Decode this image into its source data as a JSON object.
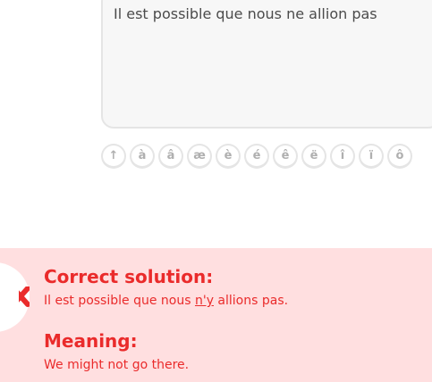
{
  "exercise": {
    "answer_value": "Il est possible que nous ne allion pas"
  },
  "keyboard": {
    "keys": [
      {
        "label": "↑",
        "name": "key-shift"
      },
      {
        "label": "à",
        "name": "key-a-grave"
      },
      {
        "label": "â",
        "name": "key-a-circumflex"
      },
      {
        "label": "æ",
        "name": "key-ae"
      },
      {
        "label": "è",
        "name": "key-e-grave"
      },
      {
        "label": "é",
        "name": "key-e-acute"
      },
      {
        "label": "ê",
        "name": "key-e-circumflex"
      },
      {
        "label": "ë",
        "name": "key-e-diaeresis"
      },
      {
        "label": "î",
        "name": "key-i-circumflex"
      },
      {
        "label": "ï",
        "name": "key-i-diaeresis"
      },
      {
        "label": "ô",
        "name": "key-o-circumflex"
      }
    ]
  },
  "feedback": {
    "status_icon": "close-icon",
    "accent_color": "#ea2b2b",
    "background_color": "#ffdfe0",
    "solution_title": "Correct solution:",
    "solution_before": "Il est possible que nous ",
    "solution_highlight": "n'y",
    "solution_after": " allions pas.",
    "meaning_title": "Meaning:",
    "meaning_text": "We might not go there."
  }
}
